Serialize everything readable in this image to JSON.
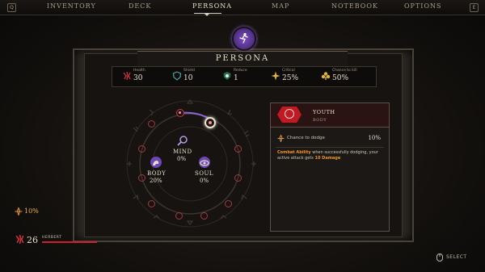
{
  "nav": {
    "left_key": "Q",
    "right_key": "E",
    "tabs": [
      {
        "label": "INVENTORY"
      },
      {
        "label": "DECK"
      },
      {
        "label": "PERSONA"
      },
      {
        "label": "MAP"
      },
      {
        "label": "NOTEBOOK"
      },
      {
        "label": "OPTIONS"
      }
    ],
    "active_tab": "PERSONA"
  },
  "panel": {
    "title": "PERSONA",
    "emblem_icon": "dancer-icon"
  },
  "stats": [
    {
      "label": "Health",
      "value": "30",
      "icon": "health-icon"
    },
    {
      "label": "Shield",
      "value": "10",
      "icon": "shield-icon"
    },
    {
      "label": "Reduce",
      "value": "1",
      "icon": "reduce-icon"
    },
    {
      "label": "Critical",
      "value": "25%",
      "icon": "critical-icon"
    },
    {
      "label": "Chance to kill",
      "value": "50%",
      "icon": "kill-icon"
    }
  ],
  "wheel": {
    "mind": {
      "label": "MIND",
      "value": "0%"
    },
    "body": {
      "label": "BODY",
      "value": "20%"
    },
    "soul": {
      "label": "SOUL",
      "value": "0%"
    }
  },
  "card": {
    "name": "YOUTH",
    "category": "BODY",
    "row_label": "Chance to dodge",
    "row_value": "10%",
    "desc_highlight": "Combat Ability",
    "desc_text_1": " when successfully dodging, your active attack gets ",
    "desc_highlight_2": "10 Damage"
  },
  "status": {
    "buff_value": "10%",
    "hp_value": "26",
    "character_name": "HERBERT",
    "hp_fraction": 0.87
  },
  "hint": {
    "select_label": "SELECT"
  },
  "colors": {
    "accent_purple": "#7a4fc2",
    "accent_red": "#c21a23",
    "highlight_orange": "#f29421"
  }
}
